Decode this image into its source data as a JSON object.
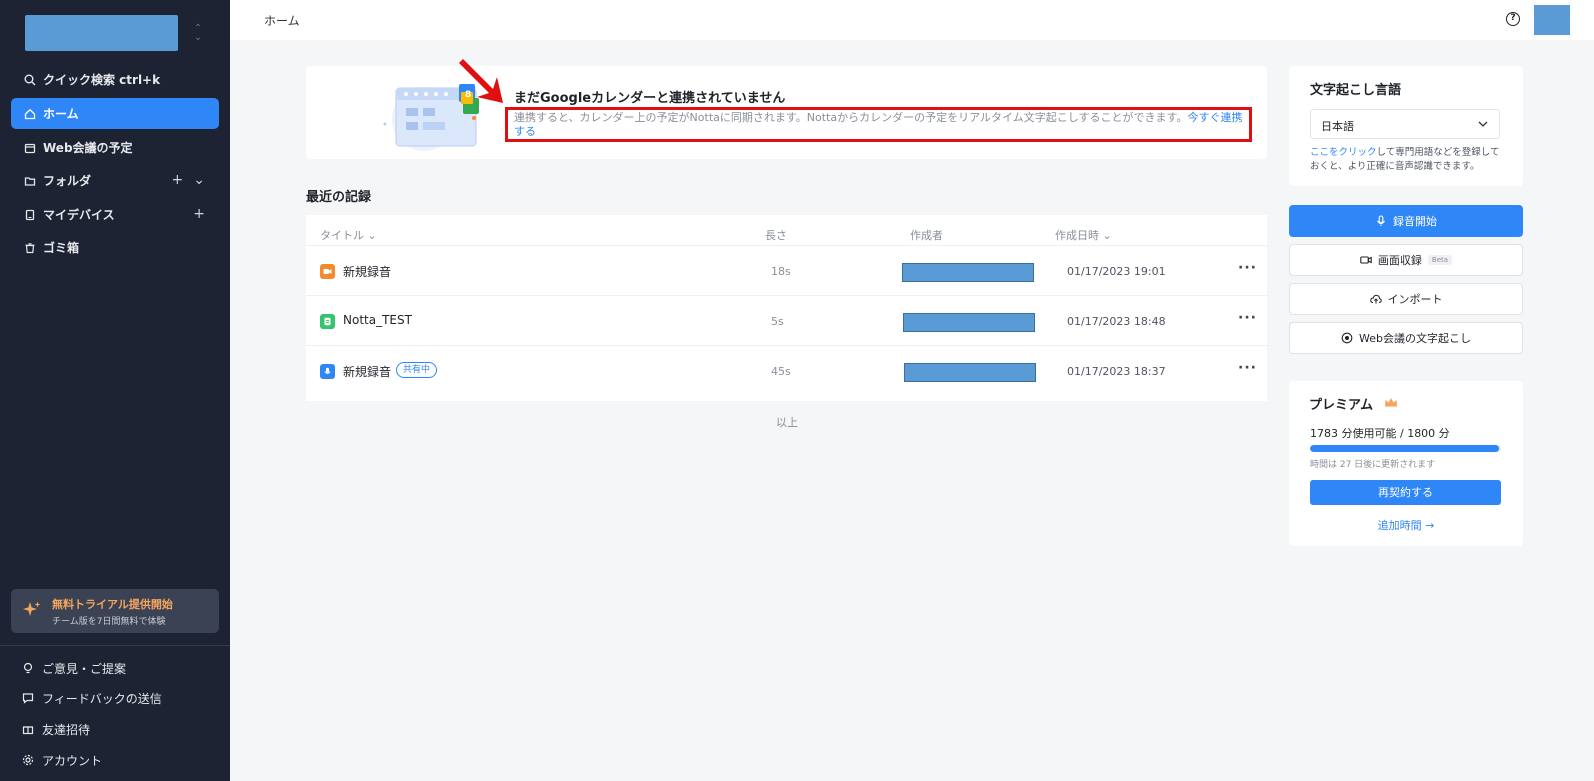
{
  "sidebar": {
    "nav": [
      {
        "label": "クイック検索 ctrl+k",
        "icon": "search-icon"
      },
      {
        "label": "ホーム",
        "icon": "home-icon"
      },
      {
        "label": "Web会議の予定",
        "icon": "calendar-icon"
      },
      {
        "label": "フォルダ",
        "icon": "folder-icon"
      },
      {
        "label": "マイデバイス",
        "icon": "device-icon"
      },
      {
        "label": "ゴミ箱",
        "icon": "trash-icon"
      }
    ],
    "trial_title": "無料トライアル提供開始",
    "trial_sub": "チーム版を7日間無料で体験",
    "footer": [
      {
        "label": "ご意見・ご提案",
        "icon": "lightbulb-icon"
      },
      {
        "label": "フィードバックの送信",
        "icon": "chat-icon"
      },
      {
        "label": "友達招待",
        "icon": "gift-icon"
      },
      {
        "label": "アカウント",
        "icon": "gear-icon"
      }
    ]
  },
  "topbar": {
    "breadcrumb": "ホーム",
    "help": "?"
  },
  "banner": {
    "title": "まだGoogleカレンダーと連携されていません",
    "desc": "連携すると、カレンダー上の予定がNottaに同期されます。Nottaからカレンダーの予定をリアルタイム文字起こしすることができます。",
    "link": "今すぐ連携する"
  },
  "records": {
    "title": "最近の記録",
    "columns": {
      "title": "タイトル",
      "length": "長さ",
      "creator": "作成者",
      "created": "作成日時"
    },
    "rows": [
      {
        "name": "新規録音",
        "length": "18s",
        "date": "01/17/2023 19:01",
        "color": "#f28b30"
      },
      {
        "name": "Notta_TEST",
        "length": "5s",
        "date": "01/17/2023 18:48",
        "color": "#35c46e"
      },
      {
        "name": "新規録音",
        "badge": "共有中",
        "length": "45s",
        "date": "01/17/2023 18:37",
        "color": "#2f86f6"
      }
    ],
    "end": "以上",
    "more": "···"
  },
  "language": {
    "title": "文字起こし言語",
    "value": "日本語",
    "note_link": "ここをクリック",
    "note": "して専門用語などを登録しておくと、より正確に音声認識できます。"
  },
  "actions": {
    "record": "録音開始",
    "screen": "画面収録",
    "beta": "Beta",
    "import": "インポート",
    "web": "Web会議の文字起こし"
  },
  "premium": {
    "title": "プレミアム",
    "usage": "1783 分使用可能 / 1800 分",
    "usage_fraction": 0.99,
    "renew": "時間は 27 日後に更新されます",
    "renew_button": "再契約する",
    "add_time": "追加時間 →"
  },
  "colors": {
    "accent": "#2f86f6",
    "sidebar": "#1d2332",
    "highlight": "#e01010"
  }
}
